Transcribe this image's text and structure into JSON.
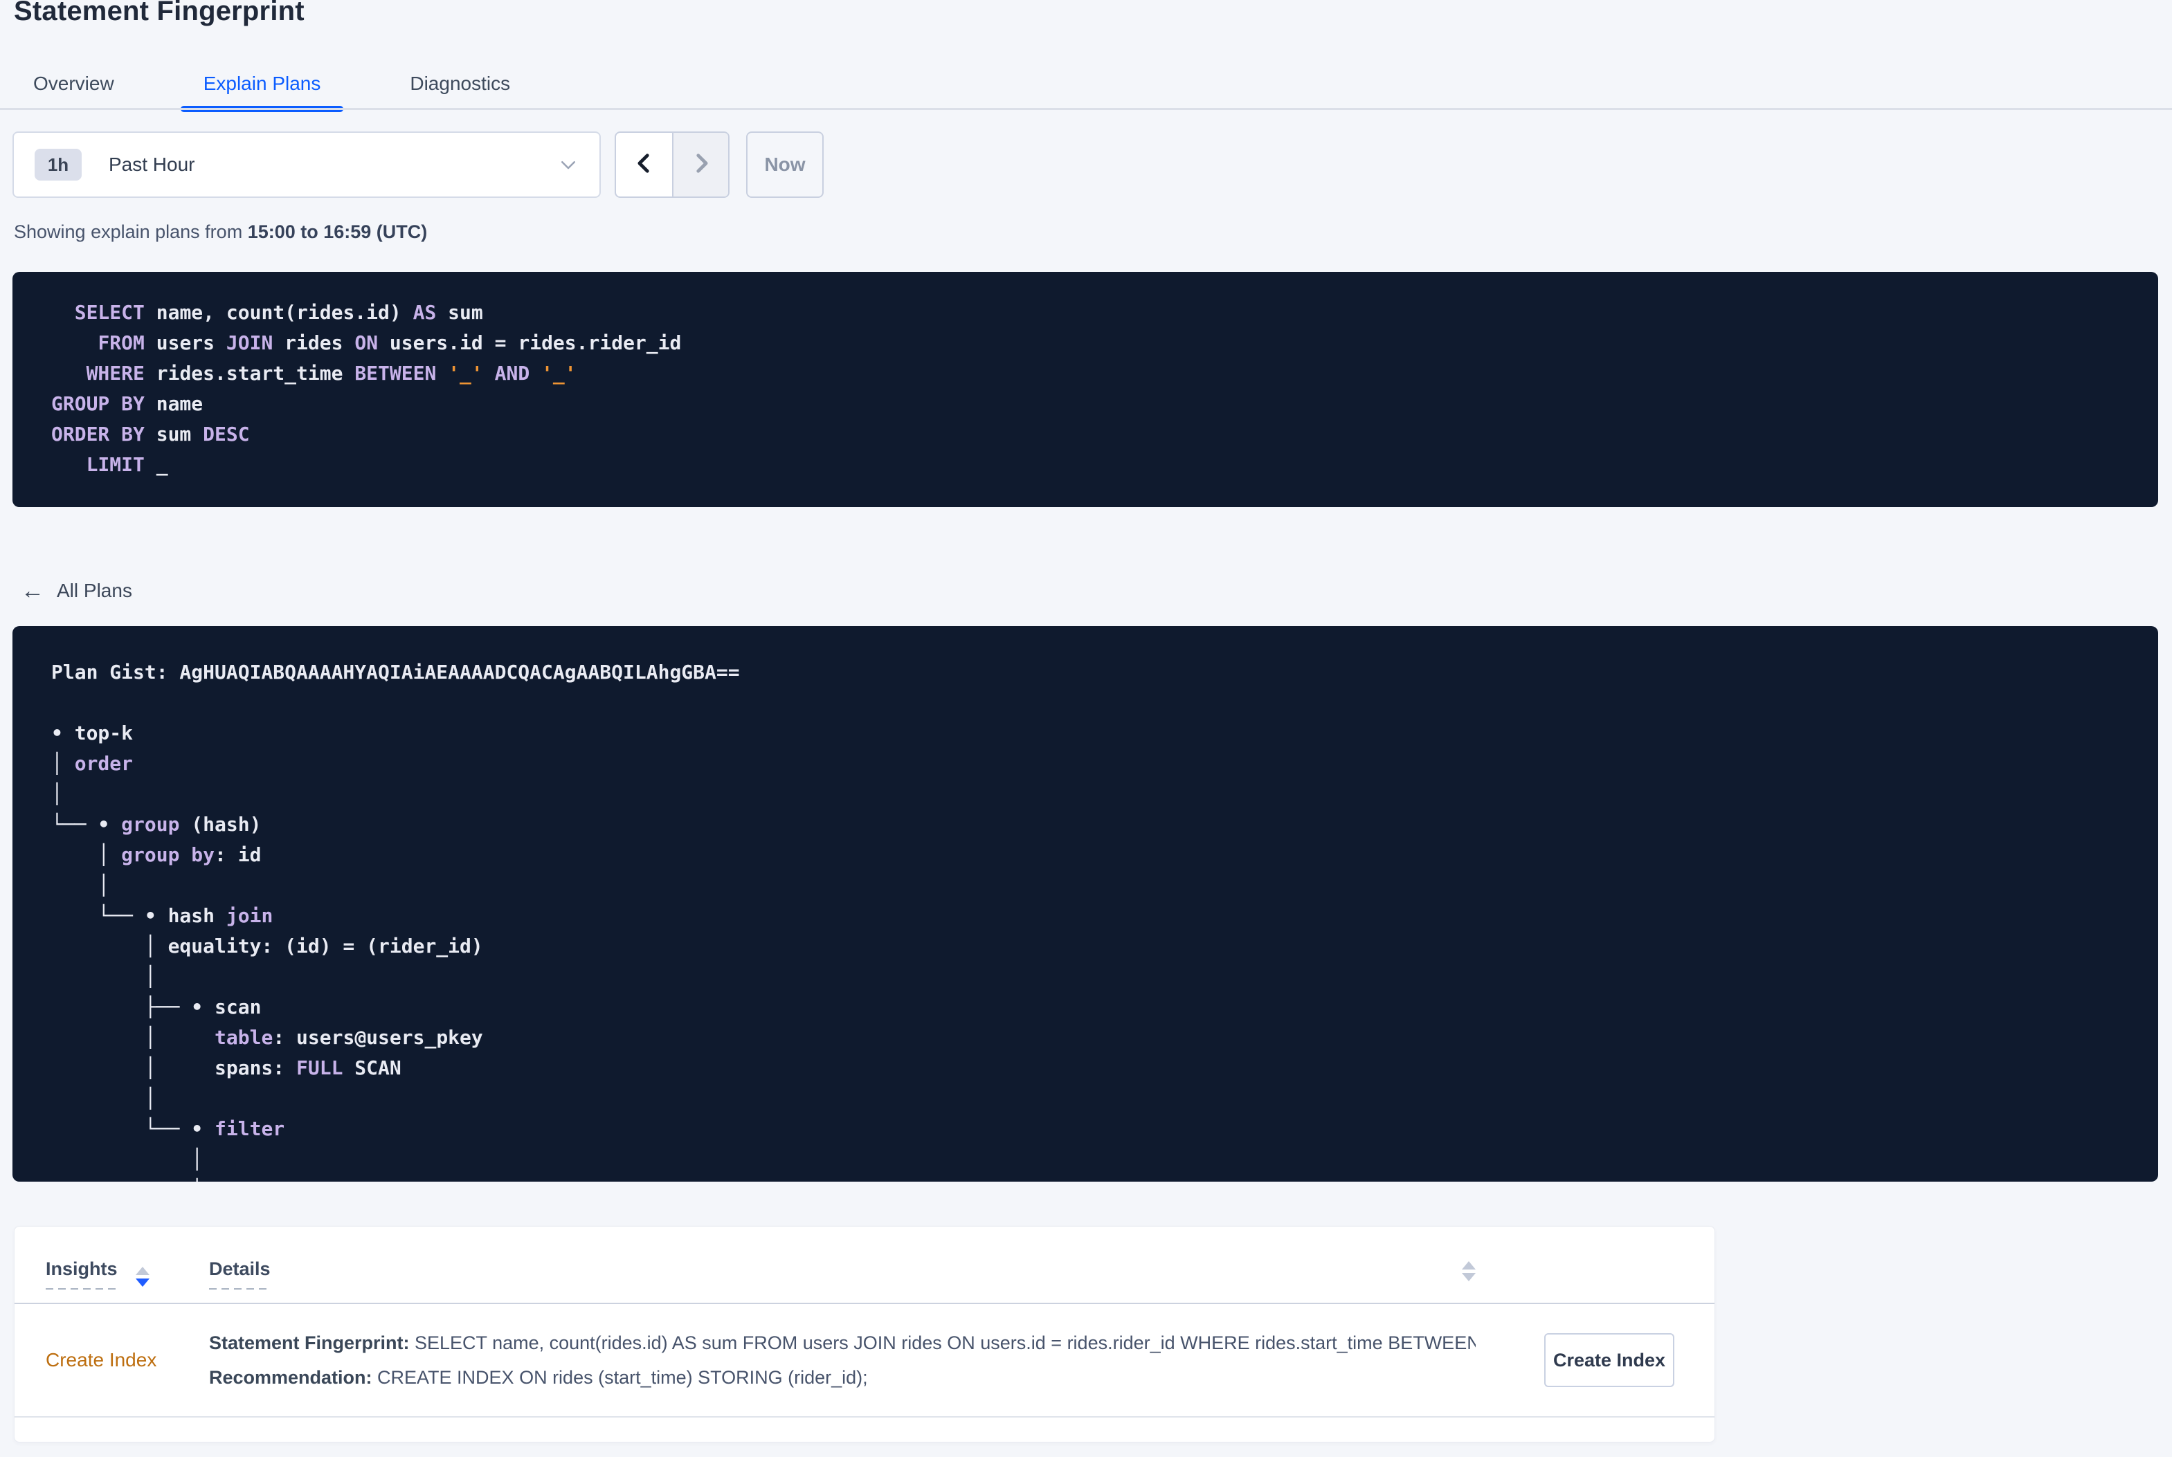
{
  "page": {
    "title": "Statement Fingerprint"
  },
  "tabs": [
    {
      "label": "Overview",
      "active": false
    },
    {
      "label": "Explain Plans",
      "active": true
    },
    {
      "label": "Diagnostics",
      "active": false
    }
  ],
  "time_picker": {
    "badge": "1h",
    "label": "Past Hour"
  },
  "time_nav": {
    "now_label": "Now"
  },
  "subtitle": {
    "prefix": "Showing explain plans from ",
    "range": "15:00 to 16:59 (UTC)"
  },
  "colors": {
    "accent_blue": "#0b5cff",
    "code_background": "#0f1a2e",
    "code_keyword": "#c8b3ea",
    "code_text": "#e9ebf3",
    "code_literal": "#ee9434",
    "insight_link": "#bd6e0f",
    "sort_active": "#1f5cff"
  },
  "sql_query": {
    "lines": [
      [
        {
          "t": "  ",
          "c": "p"
        },
        {
          "t": "SELECT",
          "c": "k"
        },
        {
          "t": " name, count(rides.id) ",
          "c": "p"
        },
        {
          "t": "AS",
          "c": "k"
        },
        {
          "t": " sum",
          "c": "p"
        }
      ],
      [
        {
          "t": "    ",
          "c": "p"
        },
        {
          "t": "FROM",
          "c": "k"
        },
        {
          "t": " users ",
          "c": "p"
        },
        {
          "t": "JOIN",
          "c": "k"
        },
        {
          "t": " rides ",
          "c": "p"
        },
        {
          "t": "ON",
          "c": "k"
        },
        {
          "t": " users.id = rides.rider_id",
          "c": "p"
        }
      ],
      [
        {
          "t": "   ",
          "c": "p"
        },
        {
          "t": "WHERE",
          "c": "k"
        },
        {
          "t": " rides.start_time ",
          "c": "p"
        },
        {
          "t": "BETWEEN",
          "c": "k"
        },
        {
          "t": " ",
          "c": "p"
        },
        {
          "t": "'_'",
          "c": "s"
        },
        {
          "t": " ",
          "c": "p"
        },
        {
          "t": "AND",
          "c": "k"
        },
        {
          "t": " ",
          "c": "p"
        },
        {
          "t": "'_'",
          "c": "s"
        }
      ],
      [
        {
          "t": "GROUP BY",
          "c": "k"
        },
        {
          "t": " name",
          "c": "p"
        }
      ],
      [
        {
          "t": "ORDER BY",
          "c": "k"
        },
        {
          "t": " sum ",
          "c": "p"
        },
        {
          "t": "DESC",
          "c": "k"
        }
      ],
      [
        {
          "t": "   ",
          "c": "p"
        },
        {
          "t": "LIMIT",
          "c": "k"
        },
        {
          "t": " _",
          "c": "p"
        }
      ]
    ]
  },
  "all_plans_label": "All Plans",
  "plan": {
    "lines": [
      [
        {
          "t": "Plan Gist: AgHUAQIABQAAAAHYAQIAiAEAAAADCQACAgAABQILAhgGBA==",
          "c": "p"
        }
      ],
      [],
      [
        {
          "t": "• top-k",
          "c": "p"
        }
      ],
      [
        {
          "t": "│ ",
          "c": "p"
        },
        {
          "t": "order",
          "c": "k"
        }
      ],
      [
        {
          "t": "│",
          "c": "p"
        }
      ],
      [
        {
          "t": "└── • ",
          "c": "p"
        },
        {
          "t": "group",
          "c": "k"
        },
        {
          "t": " (hash)",
          "c": "p"
        }
      ],
      [
        {
          "t": "    │ ",
          "c": "p"
        },
        {
          "t": "group by",
          "c": "k"
        },
        {
          "t": ": id",
          "c": "p"
        }
      ],
      [
        {
          "t": "    │",
          "c": "p"
        }
      ],
      [
        {
          "t": "    └── • hash ",
          "c": "p"
        },
        {
          "t": "join",
          "c": "k"
        }
      ],
      [
        {
          "t": "        │ equality: (id) = (rider_id)",
          "c": "p"
        }
      ],
      [
        {
          "t": "        │",
          "c": "p"
        }
      ],
      [
        {
          "t": "        ├── • scan",
          "c": "p"
        }
      ],
      [
        {
          "t": "        │     ",
          "c": "p"
        },
        {
          "t": "table",
          "c": "k"
        },
        {
          "t": ": users@users_pkey",
          "c": "p"
        }
      ],
      [
        {
          "t": "        │     spans: ",
          "c": "p"
        },
        {
          "t": "FULL",
          "c": "k"
        },
        {
          "t": " SCAN",
          "c": "p"
        }
      ],
      [
        {
          "t": "        │",
          "c": "p"
        }
      ],
      [
        {
          "t": "        └── • ",
          "c": "p"
        },
        {
          "t": "filter",
          "c": "k"
        }
      ],
      [
        {
          "t": "            │",
          "c": "p"
        }
      ],
      [
        {
          "t": "            │",
          "c": "p"
        }
      ]
    ]
  },
  "insights_table": {
    "columns": [
      {
        "label": "Insights"
      },
      {
        "label": "Details"
      }
    ],
    "rows": [
      {
        "insight": "Create Index",
        "details_line1_label": "Statement Fingerprint:",
        "details_line1_text": " SELECT name, count(rides.id) AS sum FROM users JOIN rides ON users.id = rides.rider_id WHERE rides.start_time BETWEEN '_…",
        "details_line2_label": "Recommendation:",
        "details_line2_text": " CREATE INDEX ON rides (start_time) STORING (rider_id);",
        "action_label": "Create Index"
      }
    ]
  }
}
